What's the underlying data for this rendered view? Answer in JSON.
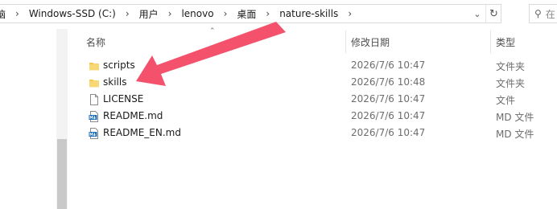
{
  "breadcrumb": {
    "items": [
      "脑",
      "Windows-SSD (C:)",
      "用户",
      "lenovo",
      "桌面",
      "nature-skills"
    ],
    "separator": "›"
  },
  "address_bar": {
    "dropdown_icon": "chevron-down-icon",
    "refresh_icon": "refresh-icon"
  },
  "search": {
    "placeholder": "在 na",
    "icon": "search-icon"
  },
  "columns": {
    "name": "名称",
    "modified": "修改日期",
    "type": "类型"
  },
  "files": [
    {
      "name": "scripts",
      "modified": "2026/7/6 10:47",
      "type": "文件夹",
      "icon": "folder-icon"
    },
    {
      "name": "skills",
      "modified": "2026/7/6 10:48",
      "type": "文件夹",
      "icon": "folder-icon"
    },
    {
      "name": "LICENSE",
      "modified": "2026/7/6 10:47",
      "type": "文件",
      "icon": "file-icon"
    },
    {
      "name": "README.md",
      "modified": "2026/7/6 10:47",
      "type": "MD 文件",
      "icon": "md-file-icon"
    },
    {
      "name": "README_EN.md",
      "modified": "2026/7/6 10:47",
      "type": "MD 文件",
      "icon": "md-file-icon"
    }
  ],
  "colors": {
    "folder": "#F3C74A",
    "annotation_arrow": "#F4516C",
    "md_icon": "#1E6FB8"
  }
}
